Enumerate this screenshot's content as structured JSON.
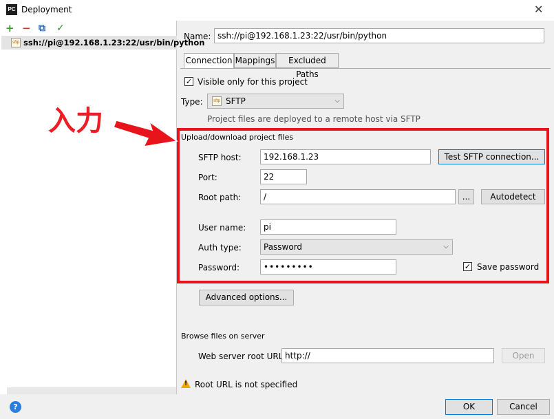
{
  "window": {
    "title": "Deployment",
    "app_icon": "PC",
    "close_glyph": "✕"
  },
  "left_toolbar": {
    "add_icon": "+",
    "remove_icon": "−",
    "copy_icon": "⧉",
    "default_icon": "✓"
  },
  "server_list": {
    "items": [
      {
        "icon_text": "sftp",
        "label": "ssh://pi@192.168.1.23:22/usr/bin/python"
      }
    ]
  },
  "name_field": {
    "label": "Name:",
    "value": "ssh://pi@192.168.1.23:22/usr/bin/python"
  },
  "tabs": [
    {
      "label": "Connection",
      "active": true
    },
    {
      "label": "Mappings"
    },
    {
      "label": "Excluded Paths"
    }
  ],
  "visible_only": {
    "checked_glyph": "✓",
    "label": "Visible only for this project"
  },
  "type": {
    "label": "Type:",
    "icon_text": "sftp",
    "value": "SFTP",
    "caret": "⌵",
    "hint": "Project files are deployed to a remote host via SFTP"
  },
  "upload_section": {
    "title": "Upload/download project files",
    "host": {
      "label": "SFTP host:",
      "value": "192.168.1.23",
      "test_button": "Test SFTP connection..."
    },
    "port": {
      "label": "Port:",
      "value": "22"
    },
    "root_path": {
      "label": "Root path:",
      "value": "/",
      "browse_button": "...",
      "autodetect_button": "Autodetect"
    },
    "user_name": {
      "label": "User name:",
      "value": "pi"
    },
    "auth_type": {
      "label": "Auth type:",
      "value": "Password",
      "caret": "⌵"
    },
    "password": {
      "label": "Password:",
      "value": "•••••••••",
      "save_checked_glyph": "✓",
      "save_label": "Save password"
    }
  },
  "advanced_button": "Advanced options...",
  "browse_section": {
    "title": "Browse files on server",
    "url_label": "Web server root URL:",
    "url_value": "http://",
    "open_button": "Open"
  },
  "warning": {
    "icon_glyph": "!",
    "text": "Root URL is not specified"
  },
  "footer": {
    "help_glyph": "?",
    "ok": "OK",
    "cancel": "Cancel"
  },
  "annotation": {
    "text": "入力"
  },
  "colors": {
    "annotation_red": "#e8141b",
    "primary_border": "#0078d7",
    "help_blue": "#2b7de0"
  }
}
